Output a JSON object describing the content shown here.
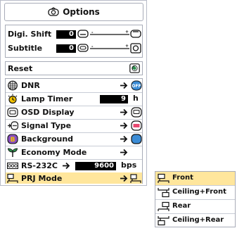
{
  "menu": {
    "title": "Options",
    "adjust_rows": [
      {
        "label": "Digi. Shift",
        "value": "0"
      },
      {
        "label": "Subtitle",
        "value": "0"
      }
    ],
    "reset_label": "Reset",
    "items": [
      {
        "label": "DNR"
      },
      {
        "label": "Lamp Timer",
        "value": "9",
        "unit": "h"
      },
      {
        "label": "OSD Display"
      },
      {
        "label": "Signal Type"
      },
      {
        "label": "Background"
      },
      {
        "label": "Economy Mode"
      },
      {
        "label": "RS-232C",
        "value": "9600",
        "unit": "bps"
      },
      {
        "label": "PRJ Mode"
      }
    ]
  },
  "submenu": {
    "items": [
      {
        "label": "Front"
      },
      {
        "label": "Ceiling+Front"
      },
      {
        "label": "Rear"
      },
      {
        "label": "Ceiling+Rear"
      }
    ],
    "selected": "Front"
  },
  "colors": {
    "highlight": "#ffe69c",
    "accent": "#3b8cd6",
    "border": "#a8acb8"
  }
}
